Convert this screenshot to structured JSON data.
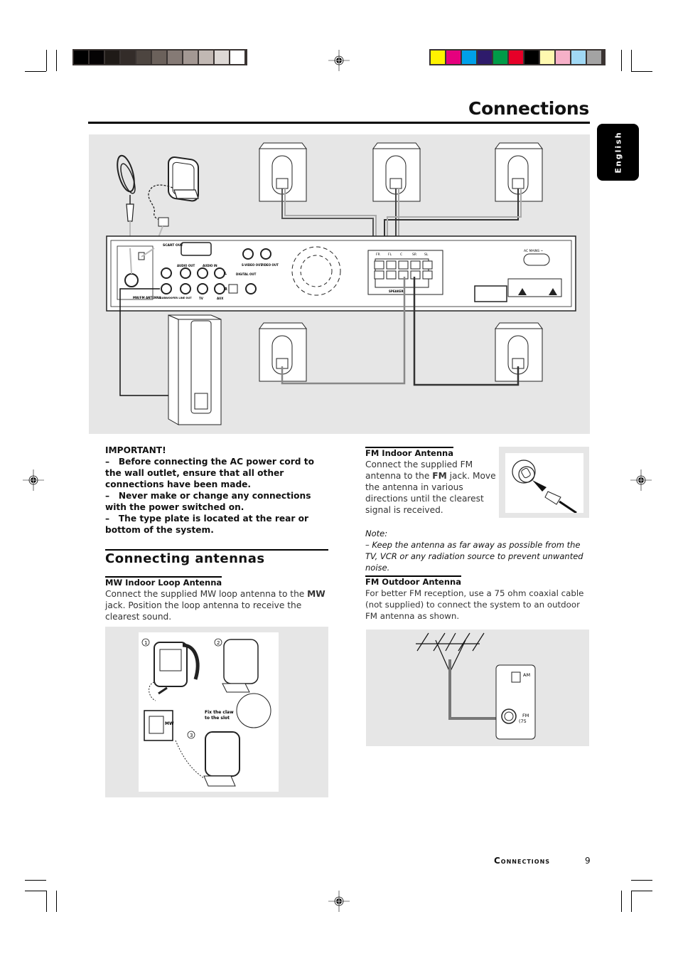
{
  "page": {
    "title": "Connections",
    "language_tab": "English",
    "footer_label": "Connections",
    "page_number": "9"
  },
  "color_bars": {
    "grayscale": [
      "#000000",
      "#050304",
      "#1f1a17",
      "#332c29",
      "#4d4540",
      "#6b615b",
      "#857a75",
      "#a39893",
      "#c1b8b3",
      "#ddd8d5",
      "#ffffff"
    ],
    "colors": [
      "#fff200",
      "#e6007e",
      "#00a0e9",
      "#2e1b6b",
      "#009b48",
      "#e60028",
      "#000000",
      "#fff9b0",
      "#f6b0c8",
      "#a0d8f4",
      "#a3a3a3"
    ]
  },
  "main_diagram": {
    "rear_panel_labels": {
      "scart_out": "SCART OUT",
      "audio_out": "AUDIO OUT",
      "audio_in": "AUDIO IN",
      "s_video_out": "S-VIDEO OUT",
      "video_out": "VIDEO OUT",
      "digital_out": "DIGITAL OUT",
      "mw_fm_antenna": "MW/FM ANTENNA",
      "subwoofer_line_out": "SUBWOOFER LINE OUT",
      "tv": "TV",
      "aux": "AUX",
      "l": "L",
      "r": "R",
      "ac_mains": "AC MAINS ~",
      "speakers": "SPEAKERS",
      "speaker_terminals": [
        "FR",
        "FL",
        "C",
        "SR",
        "SL"
      ]
    }
  },
  "important": {
    "heading": "IMPORTANT!",
    "items": [
      "Before connecting the AC power cord to the wall outlet, ensure that all other connections have been made.",
      "Never make or change any connections with the power switched on.",
      "The type plate is located at the rear or bottom of the system."
    ]
  },
  "connecting_antennas": {
    "heading": "Connecting antennas",
    "mw": {
      "heading": "MW Indoor Loop Antenna",
      "text_before": "Connect the supplied MW loop antenna to the ",
      "text_bold": "MW",
      "text_after": " jack.  Position the loop antenna to receive the clearest sound.",
      "figure": {
        "step1": "1",
        "step2": "2",
        "step3": "3",
        "caption_line1": "Fix the claw",
        "caption_line2": "to the slot",
        "jack_label": "MW"
      }
    },
    "fm_indoor": {
      "heading": "FM Indoor Antenna",
      "text_before": "Connect the supplied FM antenna to the ",
      "text_bold": "FM",
      "text_after": " jack. Move the antenna in various directions until the clearest signal is received.",
      "note_label": "Note:",
      "note_text": "–  Keep the antenna as far away as possible from the TV, VCR or any radiation source to prevent unwanted noise."
    },
    "fm_outdoor": {
      "heading": "FM Outdoor Antenna",
      "text": "For better FM reception, use a 75 ohm coaxial cable (not supplied) to connect the system to an outdoor FM antenna as shown.",
      "figure": {
        "am_label": "AM",
        "fm_label": "FM",
        "fm_sub": "(75"
      }
    }
  }
}
